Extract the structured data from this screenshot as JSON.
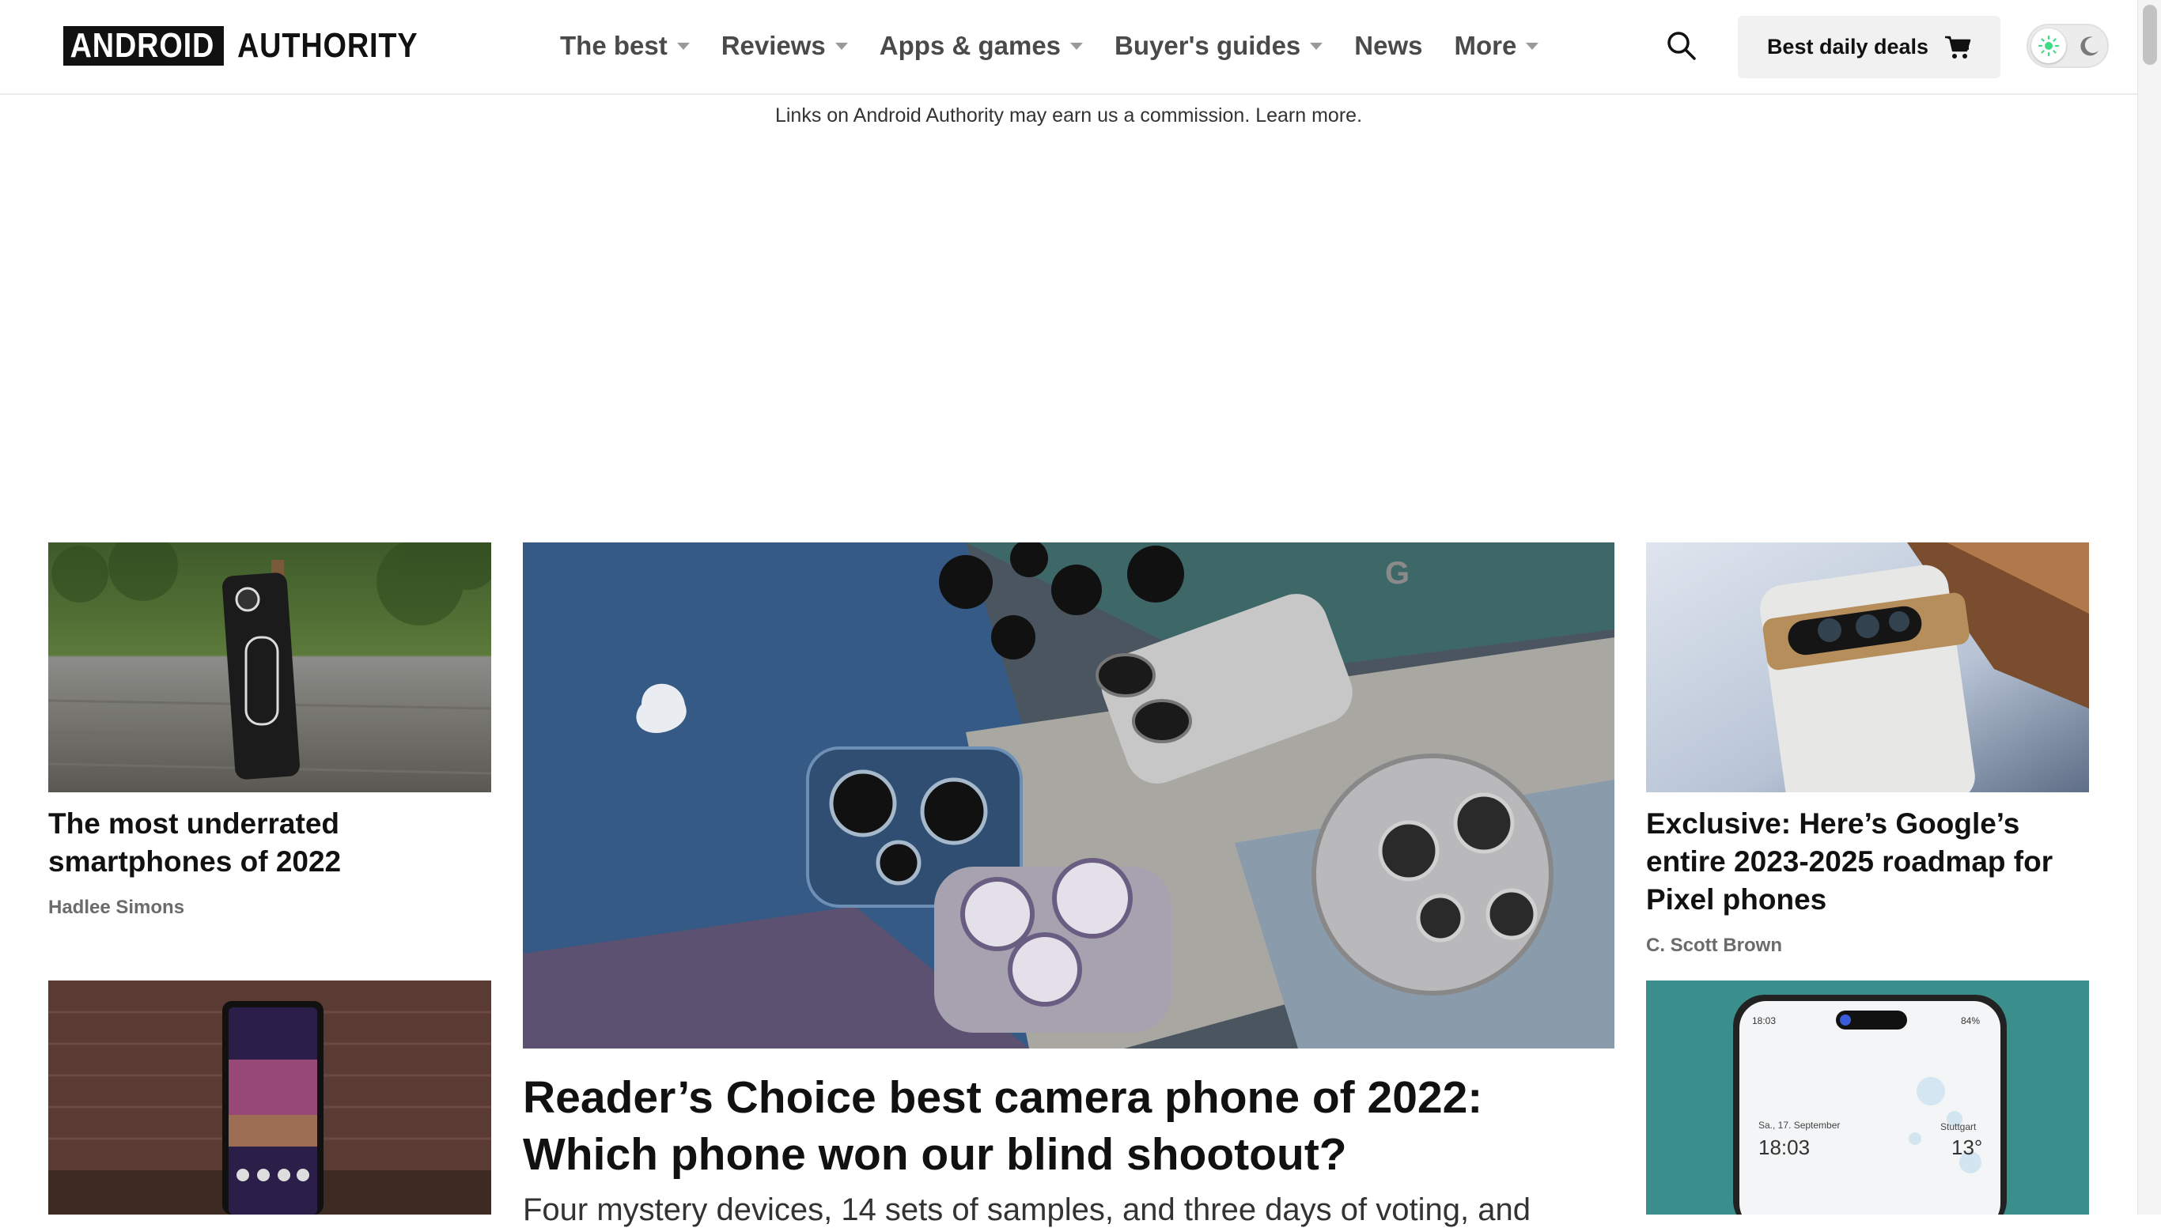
{
  "brand": {
    "logo_box": "ANDROID",
    "logo_text": "AUTHORITY"
  },
  "nav": {
    "items": [
      {
        "label": "The best",
        "has_dropdown": true
      },
      {
        "label": "Reviews",
        "has_dropdown": true
      },
      {
        "label": "Apps & games",
        "has_dropdown": true
      },
      {
        "label": "Buyer's guides",
        "has_dropdown": true
      },
      {
        "label": "News",
        "has_dropdown": false
      },
      {
        "label": "More",
        "has_dropdown": true
      }
    ]
  },
  "header": {
    "search_icon": "search-icon",
    "deals_label": "Best daily deals",
    "deals_icon": "cart-icon",
    "theme_icons": [
      "sun-icon",
      "moon-icon"
    ]
  },
  "disclaimer": {
    "text": "Links on Android Authority may earn us a commission.",
    "link": "Learn more."
  },
  "articles": {
    "left_top": {
      "title": "The most underrated smartphones of 2022",
      "author": "Hadlee Simons"
    },
    "hero": {
      "title": "Reader’s Choice best camera phone of 2022: Which phone won our blind shootout?",
      "deck": "Four mystery devices, 14 sets of samples, and three days of voting, and"
    },
    "right_top": {
      "title": "Exclusive: Here’s Google’s entire 2023-2025 roadmap for Pixel phones",
      "author": "C. Scott Brown"
    },
    "right_bottom_image": {
      "date": "Sa., 17. September",
      "time": "18:03",
      "city": "Stuttgart",
      "temp": "13°",
      "status_time": "18:03",
      "battery": "84%"
    }
  },
  "colors": {
    "accent_green": "#3ddc84",
    "text": "#111111",
    "nav_text": "#4a4a4a"
  }
}
